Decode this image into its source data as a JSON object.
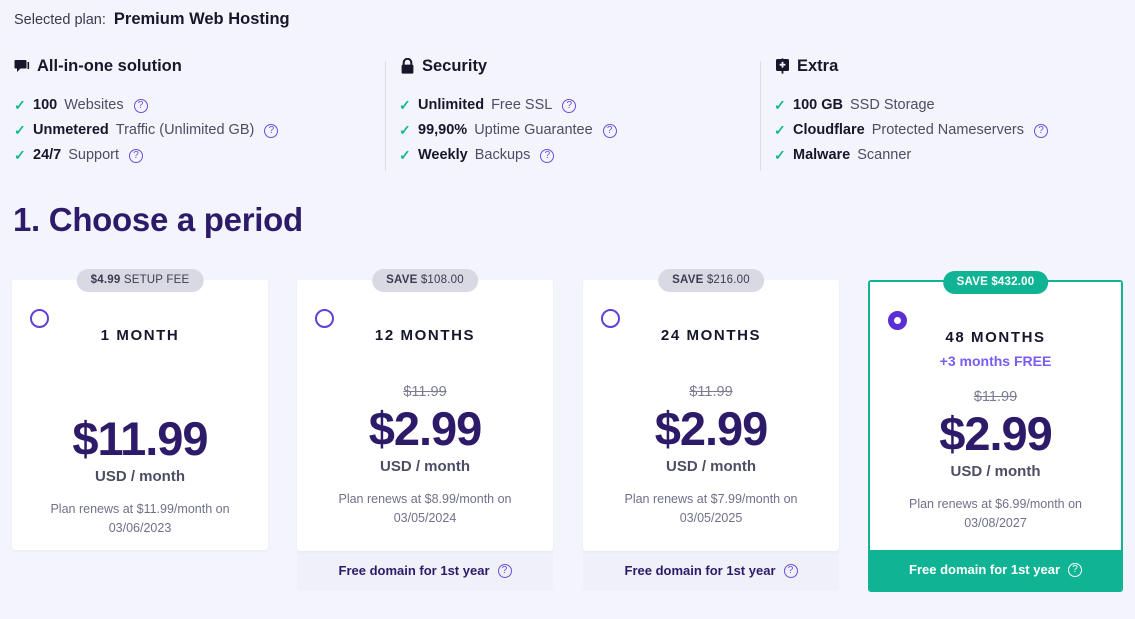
{
  "header": {
    "selected_plan_label": "Selected plan:",
    "selected_plan_value": "Premium Web Hosting"
  },
  "feature_groups": [
    {
      "icon": "chat-bubble-icon",
      "title": "All-in-one solution",
      "items": [
        {
          "strong": "100",
          "rest": " Websites",
          "help": true
        },
        {
          "strong": "Unmetered",
          "rest": " Traffic (Unlimited GB)",
          "help": true
        },
        {
          "strong": "24/7",
          "rest": " Support",
          "help": true
        }
      ]
    },
    {
      "icon": "lock-icon",
      "title": "Security",
      "items": [
        {
          "strong": "Unlimited",
          "rest": " Free SSL",
          "help": true
        },
        {
          "strong": "99,90%",
          "rest": " Uptime Guarantee",
          "help": true
        },
        {
          "strong": "Weekly",
          "rest": " Backups",
          "help": true
        }
      ]
    },
    {
      "icon": "plus-box-icon",
      "title": "Extra",
      "items": [
        {
          "strong": "100 GB",
          "rest": " SSD Storage",
          "help": false
        },
        {
          "strong": "Cloudflare",
          "rest": " Protected Nameservers",
          "help": true
        },
        {
          "strong": "Malware",
          "rest": " Scanner",
          "help": false
        }
      ]
    }
  ],
  "section": {
    "title": "1. Choose a period"
  },
  "plans": [
    {
      "badge_bold": "$4.99",
      "badge_rest": " SETUP FEE",
      "badge_style": "gray",
      "term": "1 MONTH",
      "bonus": "",
      "old_price": "",
      "price": "$11.99",
      "unit": "USD / month",
      "renew_line1": "Plan renews at $11.99/month on",
      "renew_line2": "03/06/2023",
      "footer": "",
      "selected": false
    },
    {
      "badge_bold": "SAVE",
      "badge_rest": " $108.00",
      "badge_style": "gray",
      "term": "12 MONTHS",
      "bonus": "",
      "old_price": "$11.99",
      "price": "$2.99",
      "unit": "USD / month",
      "renew_line1": "Plan renews at $8.99/month on",
      "renew_line2": "03/05/2024",
      "footer": "Free domain for 1st year",
      "selected": false
    },
    {
      "badge_bold": "SAVE",
      "badge_rest": " $216.00",
      "badge_style": "gray",
      "term": "24 MONTHS",
      "bonus": "",
      "old_price": "$11.99",
      "price": "$2.99",
      "unit": "USD / month",
      "renew_line1": "Plan renews at $7.99/month on",
      "renew_line2": "03/05/2025",
      "footer": "Free domain for 1st year",
      "selected": false
    },
    {
      "badge_bold": "SAVE",
      "badge_rest": " $432.00",
      "badge_style": "teal",
      "term": "48 MONTHS",
      "bonus": "+3 months FREE",
      "old_price": "$11.99",
      "price": "$2.99",
      "unit": "USD / month",
      "renew_line1": "Plan renews at $6.99/month on",
      "renew_line2": "03/08/2027",
      "footer": "Free domain for 1st year",
      "selected": true
    }
  ],
  "colors": {
    "page_bg": "#f4f4fd",
    "accent_purple": "#2d1b69",
    "radio_purple": "#5b2fd4",
    "teal": "#10b394",
    "check_green": "#13b796",
    "badge_gray": "#d9d9e3",
    "bonus_violet": "#7b5cf0"
  }
}
